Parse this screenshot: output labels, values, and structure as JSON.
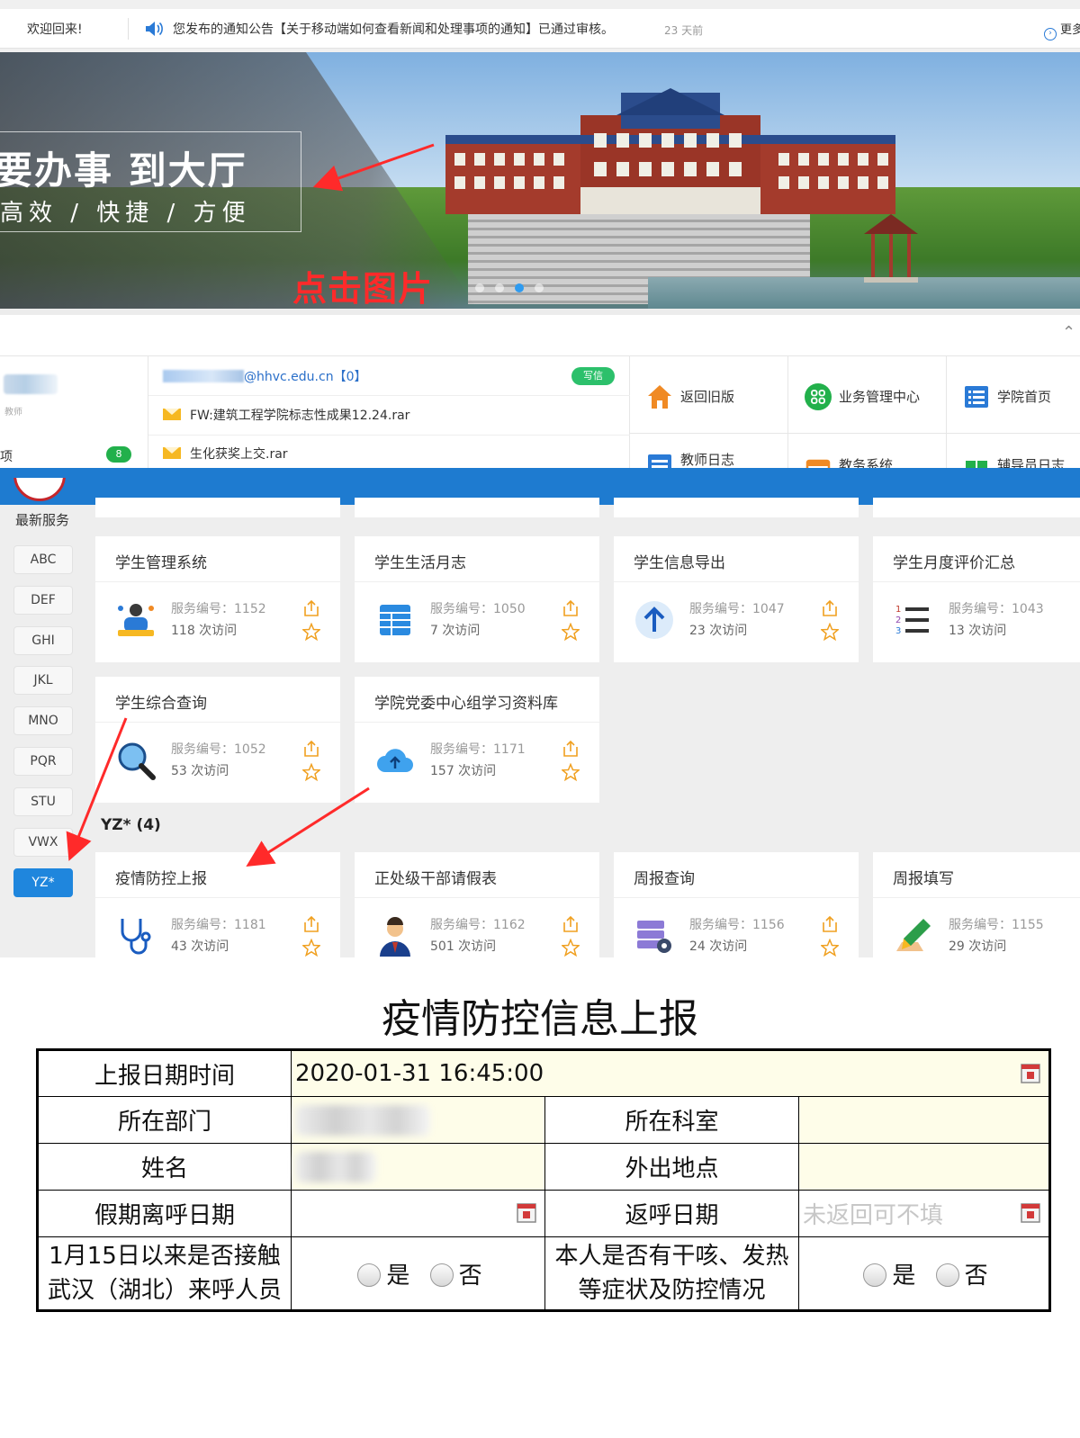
{
  "notice_bar": {
    "welcome": "欢迎回来!",
    "notice": "您发布的通知公告【关于移动端如何查看新闻和处理事项的通知】已通过审核。",
    "time": "23 天前",
    "more": "更多"
  },
  "banner": {
    "headline": "要办事 到大厅",
    "subline": "高效 / 快捷 / 方便",
    "annotation": "点击图片",
    "dot_count": 4,
    "active_dot": 3
  },
  "portal": {
    "role": "教师",
    "todo_label": "项",
    "todo_count": "8",
    "mail_address": "@hhvc.edu.cn【0】",
    "compose": "写信",
    "mails": [
      "FW:建筑工程学院标志性成果12.24.rar",
      "生化获奖上交.rar"
    ],
    "quick_links": [
      "返回旧版",
      "业务管理中心",
      "学院首页",
      "教师日志",
      "教务系统",
      "辅导员日志"
    ]
  },
  "services": {
    "latest_label": "最新服务",
    "letters": [
      "ABC",
      "DEF",
      "GHI",
      "JKL",
      "MNO",
      "PQR",
      "STU",
      "VWX",
      "YZ*"
    ],
    "active_letter": "YZ*",
    "group_heading": "YZ* (4)",
    "cards": [
      {
        "title": "学生管理系统",
        "code": "服务编号：1152",
        "visits": "118 次访问",
        "icon": "student-management-icon"
      },
      {
        "title": "学生生活月志",
        "code": "服务编号：1050",
        "visits": "7 次访问",
        "icon": "table-grid-icon"
      },
      {
        "title": "学生信息导出",
        "code": "服务编号：1047",
        "visits": "23 次访问",
        "icon": "upload-arrow-icon"
      },
      {
        "title": "学生月度评价汇总",
        "code": "服务编号：1043",
        "visits": "13 次访问",
        "icon": "numbered-list-icon"
      },
      {
        "title": "学生综合查询",
        "code": "服务编号：1052",
        "visits": "53 次访问",
        "icon": "magnifier-icon"
      },
      {
        "title": "学院党委中心组学习资料库",
        "code": "服务编号：1171",
        "visits": "157 次访问",
        "icon": "cloud-upload-icon"
      },
      {
        "title": "疫情防控上报",
        "code": "服务编号：1181",
        "visits": "43 次访问",
        "icon": "stethoscope-icon"
      },
      {
        "title": "正处级干部请假表",
        "code": "服务编号：1162",
        "visits": "501 次访问",
        "icon": "officer-icon"
      },
      {
        "title": "周报查询",
        "code": "服务编号：1156",
        "visits": "24 次访问",
        "icon": "database-gear-icon"
      },
      {
        "title": "周报填写",
        "code": "服务编号：1155",
        "visits": "29 次访问",
        "icon": "pen-writing-icon"
      }
    ]
  },
  "form": {
    "title": "疫情防控信息上报",
    "report_time_label": "上报日期时间",
    "report_time_value": "2020-01-31 16:45:00",
    "department_label": "所在部门",
    "office_label": "所在科室",
    "name_label": "姓名",
    "outing_place_label": "外出地点",
    "leave_date_label": "假期离呼日期",
    "return_date_label": "返呼日期",
    "return_date_placeholder": "未返回可不填",
    "contact_question": "1月15日以来是否接触武汉（湖北）来呼人员",
    "symptom_question": "本人是否有干咳、发热等症状及防控情况",
    "yes": "是",
    "no": "否"
  },
  "colors": {
    "primary_blue": "#1e7bd0",
    "annotation_red": "#ff2a2a",
    "badge_green": "#22b04b",
    "form_input_bg": "#fefde9"
  }
}
